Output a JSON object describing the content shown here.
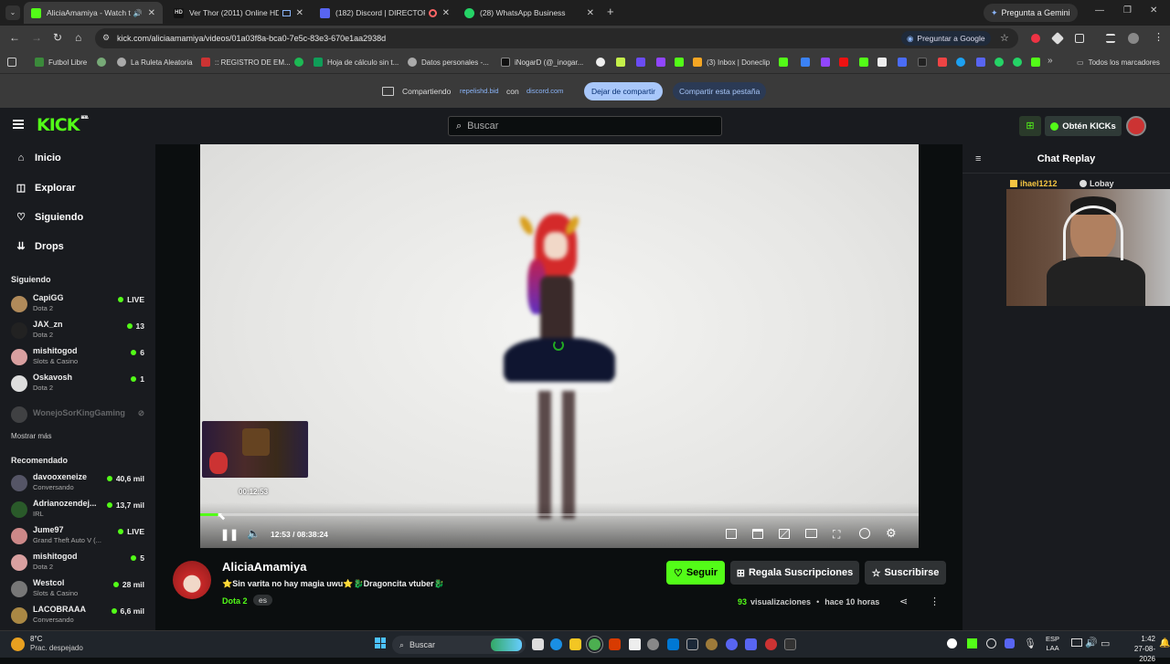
{
  "browser": {
    "tabs": [
      {
        "label": "AliciaAmamiya - Watch the",
        "color": "#53fc18"
      },
      {
        "label": "Ver Thor (2011) Online HD",
        "color": "#2a2a2a"
      },
      {
        "label": "(182) Discord | DIRECTORIO",
        "color": "#5865f2"
      },
      {
        "label": "(28) WhatsApp Business",
        "color": "#25d366"
      }
    ],
    "gemini_label": "Pregunta a Gemini",
    "url": "kick.com/aliciaamamiya/videos/01a03f8a-bca0-7e5c-83e3-670e1aa2938d",
    "ask_google": "Preguntar a Google",
    "bookmarks": [
      "Futbol Libre",
      "La Ruleta Aleatoria",
      ":: REGISTRO DE EM...",
      "Hoja de cálculo sin t...",
      "Datos personales -...",
      "iNogarD (@_inogar...",
      "(3) Inbox | Doneclip"
    ],
    "all_bookmarks": "Todos los marcadores",
    "share": {
      "sharing_label": "Compartiendo",
      "site": "repelishd.bid",
      "with": "con",
      "target": "discord.com",
      "stop": "Dejar de compartir",
      "share_tab": "Compartir esta pestaña"
    }
  },
  "kick": {
    "search_placeholder": "Buscar",
    "get_kicks": "Obtén KICKs",
    "nav": [
      {
        "label": "Inicio",
        "icon": "home-icon"
      },
      {
        "label": "Explorar",
        "icon": "compass-icon"
      },
      {
        "label": "Siguiendo",
        "icon": "heart-icon"
      },
      {
        "label": "Drops",
        "icon": "drops-icon"
      }
    ],
    "following_title": "Siguiendo",
    "following": [
      {
        "name": "CapiGG",
        "category": "Dota 2",
        "count": "LIVE",
        "color": "#b08a5a"
      },
      {
        "name": "JAX_zn",
        "category": "Dota 2",
        "count": "13",
        "color": "#222"
      },
      {
        "name": "mishitogod",
        "category": "Slots & Casino",
        "count": "6",
        "color": "#d9a0a0"
      },
      {
        "name": "Oskavosh",
        "category": "Dota 2",
        "count": "1",
        "color": "#ddd"
      }
    ],
    "offline_channel": "WonejoSorKingGaming",
    "show_more": "Mostrar más",
    "recommended_title": "Recomendado",
    "recommended": [
      {
        "name": "davooxeneize",
        "category": "Conversando",
        "count": "40,6 mil",
        "color": "#556"
      },
      {
        "name": "Adrianozendej...",
        "category": "IRL",
        "count": "13,7 mil",
        "color": "#2a5a2a"
      },
      {
        "name": "Jume97",
        "category": "Grand Theft Auto V (...",
        "count": "LIVE",
        "color": "#c88"
      },
      {
        "name": "mishitogod",
        "category": "Dota 2",
        "count": "5",
        "color": "#d9a0a0"
      },
      {
        "name": "Westcol",
        "category": "Slots & Casino",
        "count": "28 mil",
        "color": "#777"
      },
      {
        "name": "LACOBRAAA",
        "category": "Conversando",
        "count": "6,6 mil",
        "color": "#a84"
      }
    ],
    "player": {
      "hover_time": "00:12:53",
      "time": "12:53 / 08:38:24",
      "progress": 0.025
    },
    "chat_title": "Chat Replay",
    "chat_users": [
      "ihael1212",
      "Lobay"
    ],
    "streamer": {
      "name": "AliciaAmamiya",
      "title": "⭐Sin varita no hay magia uwu⭐🐉Dragoncita vtuber🐉",
      "category": "Dota 2",
      "lang": "es",
      "views": "93",
      "views_label": "visualizaciones",
      "ago": "hace 10 horas",
      "follow": "Seguir",
      "gift": "Regala Suscripciones",
      "subscribe": "Suscribirse"
    }
  },
  "taskbar": {
    "temp": "8°C",
    "weather": "Prac. despejado",
    "search": "Buscar",
    "lang1": "ESP",
    "lang2": "LAA",
    "time": "1:42",
    "date": "27-08-2026"
  },
  "colors": {
    "kick_green": "#53fc18",
    "chrome_blue": "#8ab4f8"
  }
}
